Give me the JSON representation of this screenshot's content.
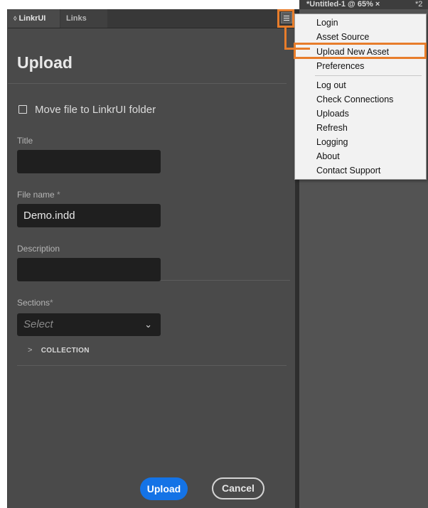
{
  "panel": {
    "tabs": [
      {
        "label": "LinkrUI",
        "active": true
      },
      {
        "label": "Links",
        "active": false
      }
    ],
    "title": "Upload",
    "move_checkbox_label": "Move file to LinkrUI folder",
    "fields": {
      "title_label": "Title",
      "title_value": "",
      "filename_label": "File name",
      "filename_value": "Demo.indd",
      "description_label": "Description",
      "description_value": "",
      "sections_label": "Sections",
      "sections_placeholder": "Select",
      "required_mark": "*"
    },
    "collection_label": "COLLECTION",
    "upload_button": "Upload",
    "cancel_button": "Cancel"
  },
  "document": {
    "tab_label": "*Untitled-1 @ 65% ×",
    "tab2_label": "*2"
  },
  "menu": {
    "items_group1": [
      "Login",
      "Asset Source",
      "Upload New Asset",
      "Preferences"
    ],
    "items_group2": [
      "Log out",
      "Check Connections",
      "Uploads",
      "Refresh",
      "Logging",
      "About",
      "Contact Support"
    ],
    "highlighted_item": "Upload New Asset"
  },
  "colors": {
    "highlight": "#e77d2b",
    "primary_button": "#1473e6",
    "panel_bg": "#4a4a4a",
    "field_bg": "#1f1f1f"
  },
  "icons": [
    "panel-menu-icon",
    "dropdown-chevron-icon",
    "collection-expand-icon",
    "collapse-arrows-icon"
  ]
}
